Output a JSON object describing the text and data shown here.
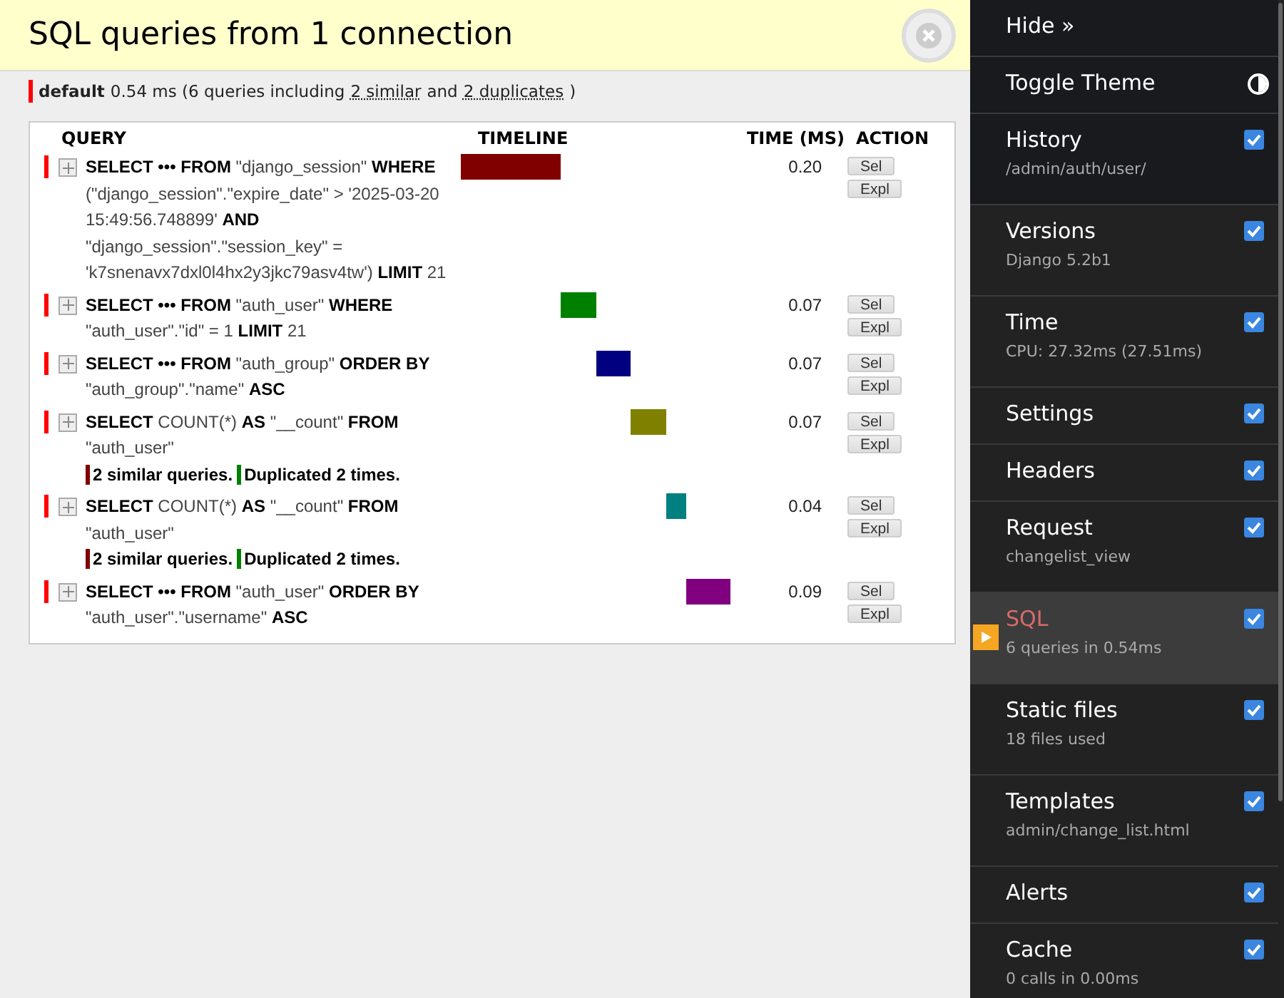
{
  "panel": {
    "title": "SQL queries from 1 connection"
  },
  "summary": {
    "alias": "default",
    "text": "0.54 ms (6 queries including",
    "similar": "2 similar",
    "and": "and",
    "duplicates": "2 duplicates",
    "close": ")",
    "color": "#ff0000"
  },
  "table": {
    "columns": [
      "QUERY",
      "TIMELINE",
      "TIME (MS)",
      "ACTION"
    ],
    "rows": [
      {
        "sql": "**SELECT ••• FROM** \"django_session\" **WHERE** (\"django_session\".\"expire_date\" > '2025-03-20 15:49:56.748899' **AND** \"django_session\".\"session_key\" = 'k7snenavx7dxl0l4hx2y3jkc79asv4tw') **LIMIT** 21",
        "time": "0.20",
        "color": "#800000",
        "notes": [],
        "buttons": [
          "Sel",
          "Expl"
        ]
      },
      {
        "sql": "**SELECT ••• FROM** \"auth_user\" **WHERE** \"auth_user\".\"id\" = 1 **LIMIT** 21",
        "time": "0.07",
        "color": "#008000",
        "notes": [],
        "buttons": [
          "Sel",
          "Expl"
        ]
      },
      {
        "sql": "**SELECT ••• FROM** \"auth_group\" **ORDER BY** \"auth_group\".\"name\" **ASC**",
        "time": "0.07",
        "color": "#000080",
        "notes": [],
        "buttons": [
          "Sel",
          "Expl"
        ]
      },
      {
        "sql": "**SELECT** COUNT(*) **AS** \"__count\" **FROM** \"auth_user\"",
        "time": "0.07",
        "color": "#808000",
        "notes": [
          {
            "text": "2 similar queries.",
            "color": "#800000"
          },
          {
            "text": "Duplicated 2 times.",
            "color": "#008000"
          }
        ],
        "buttons": [
          "Sel",
          "Expl"
        ]
      },
      {
        "sql": "**SELECT** COUNT(*) **AS** \"__count\" **FROM** \"auth_user\"",
        "time": "0.04",
        "color": "#008080",
        "notes": [
          {
            "text": "2 similar queries.",
            "color": "#800000"
          },
          {
            "text": "Duplicated 2 times.",
            "color": "#008000"
          }
        ],
        "buttons": [
          "Sel",
          "Expl"
        ]
      },
      {
        "sql": "**SELECT ••• FROM** \"auth_user\" **ORDER BY** \"auth_user\".\"username\" **ASC**",
        "time": "0.09",
        "color": "#800080",
        "notes": [],
        "buttons": [
          "Sel",
          "Expl"
        ]
      }
    ]
  },
  "toolbar": {
    "items": [
      {
        "kind": "link",
        "title": "Hide »"
      },
      {
        "kind": "theme",
        "title": "Toggle Theme"
      },
      {
        "kind": "panel",
        "title": "History",
        "subtitle": "/admin/auth/user/",
        "checked": true,
        "selected": false
      },
      {
        "kind": "panel",
        "title": "Versions",
        "subtitle": "Django 5.2b1",
        "checked": true,
        "selected": false
      },
      {
        "kind": "panel",
        "title": "Time",
        "subtitle": "CPU: 27.32ms (27.51ms)",
        "checked": true,
        "selected": false
      },
      {
        "kind": "panel",
        "title": "Settings",
        "checked": true,
        "selected": false
      },
      {
        "kind": "panel",
        "title": "Headers",
        "checked": true,
        "selected": false
      },
      {
        "kind": "panel",
        "title": "Request",
        "subtitle": "changelist_view",
        "checked": true,
        "selected": false
      },
      {
        "kind": "panel",
        "title": "SQL",
        "subtitle": "6 queries in 0.54ms",
        "checked": true,
        "selected": true
      },
      {
        "kind": "panel",
        "title": "Static files",
        "subtitle": "18 files used",
        "checked": true,
        "selected": false
      },
      {
        "kind": "panel",
        "title": "Templates",
        "subtitle": "admin/change_list.html",
        "checked": true,
        "selected": false
      },
      {
        "kind": "panel",
        "title": "Alerts",
        "checked": true,
        "selected": false
      },
      {
        "kind": "panel",
        "title": "Cache",
        "subtitle": "0 calls in 0.00ms",
        "checked": true,
        "selected": false
      }
    ]
  }
}
